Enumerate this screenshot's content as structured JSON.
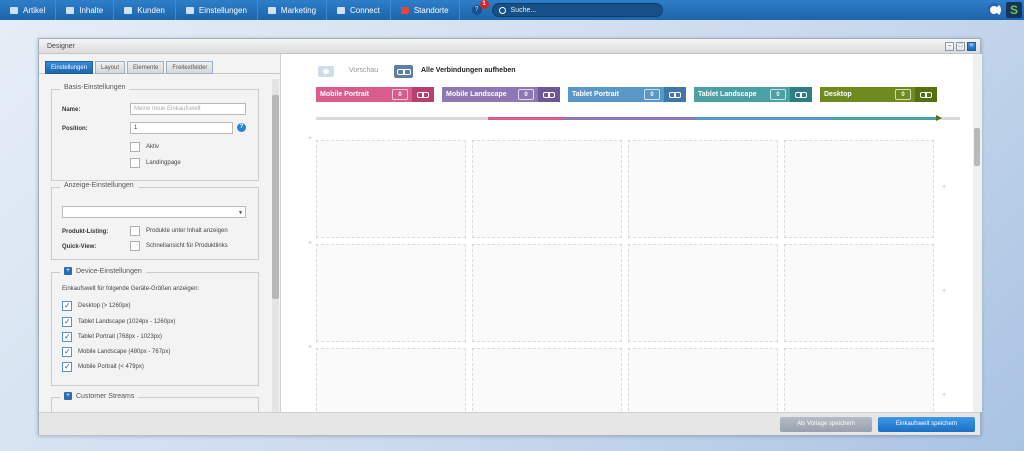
{
  "nav": {
    "items": [
      {
        "label": "Artikel",
        "icon": "artikel-icon"
      },
      {
        "label": "Inhalte",
        "icon": "inhalte-icon"
      },
      {
        "label": "Kunden",
        "icon": "kunden-icon"
      },
      {
        "label": "Einstellungen",
        "icon": "einstellungen-icon"
      },
      {
        "label": "Marketing",
        "icon": "marketing-icon"
      },
      {
        "label": "Connect",
        "icon": "connect-icon"
      },
      {
        "label": "Standorte",
        "icon": "standorte-icon"
      }
    ],
    "help_label": "?",
    "notification_count": "1",
    "search_placeholder": "Suche..."
  },
  "brand": {
    "logo_text": "S",
    "accent": "#79c341"
  },
  "window": {
    "title": "Designer"
  },
  "tabs": [
    {
      "label": "Einstellungen",
      "active": true
    },
    {
      "label": "Layout",
      "active": false
    },
    {
      "label": "Elemente",
      "active": false
    },
    {
      "label": "Freitextfelder",
      "active": false
    }
  ],
  "basis": {
    "legend": "Basis-Einstellungen",
    "name_label": "Name:",
    "name_placeholder": "Meine neue Einkaufswelt",
    "position_label": "Position:",
    "position_value": "1",
    "aktiv_label": "Aktiv",
    "landingpage_label": "Landingpage"
  },
  "anzeige": {
    "legend": "Anzeige-Einstellungen",
    "select_value": "",
    "listing_label": "Produkt-Listing:",
    "listing_text": "Produkte unter Inhalt anzeigen",
    "quickview_label": "Quick-View:",
    "quickview_text": "Schnellansicht für Produktlinks"
  },
  "device": {
    "legend": "Device-Einstellungen",
    "intro": "Einkaufswelt für folgende Geräte-Größen anzeigen:",
    "items": [
      {
        "label": "Desktop (> 1260px)",
        "checked": true
      },
      {
        "label": "Tablet Landscape (1024px - 1260px)",
        "checked": true
      },
      {
        "label": "Tablet Portrait (768px - 1023px)",
        "checked": true
      },
      {
        "label": "Mobile Landscape (480px - 767px)",
        "checked": true
      },
      {
        "label": "Mobile Portrait (< 479px)",
        "checked": true
      }
    ]
  },
  "streams": {
    "legend": "Customer Streams"
  },
  "toolbar": {
    "preview_label": "Vorschau",
    "unlink_label": "Alle Verbindungen aufheben"
  },
  "viewports": [
    {
      "name": "Mobile Portrait",
      "count": "0",
      "color": "#d95c8c",
      "dark": "#b8406f"
    },
    {
      "name": "Mobile Landscape",
      "count": "0",
      "color": "#8f77b5",
      "dark": "#6d5794"
    },
    {
      "name": "Tablet Portrait",
      "count": "0",
      "color": "#5a97c9",
      "dark": "#3f78a8"
    },
    {
      "name": "Tablet Landscape",
      "count": "0",
      "color": "#4aa0a3",
      "dark": "#2f7d80"
    },
    {
      "name": "Desktop",
      "count": "0",
      "color": "#6f8a1f",
      "dark": "#55700f"
    }
  ],
  "footer": {
    "template_button": "Als Vorlage speichern",
    "save_button": "Einkaufswelt speichern"
  }
}
